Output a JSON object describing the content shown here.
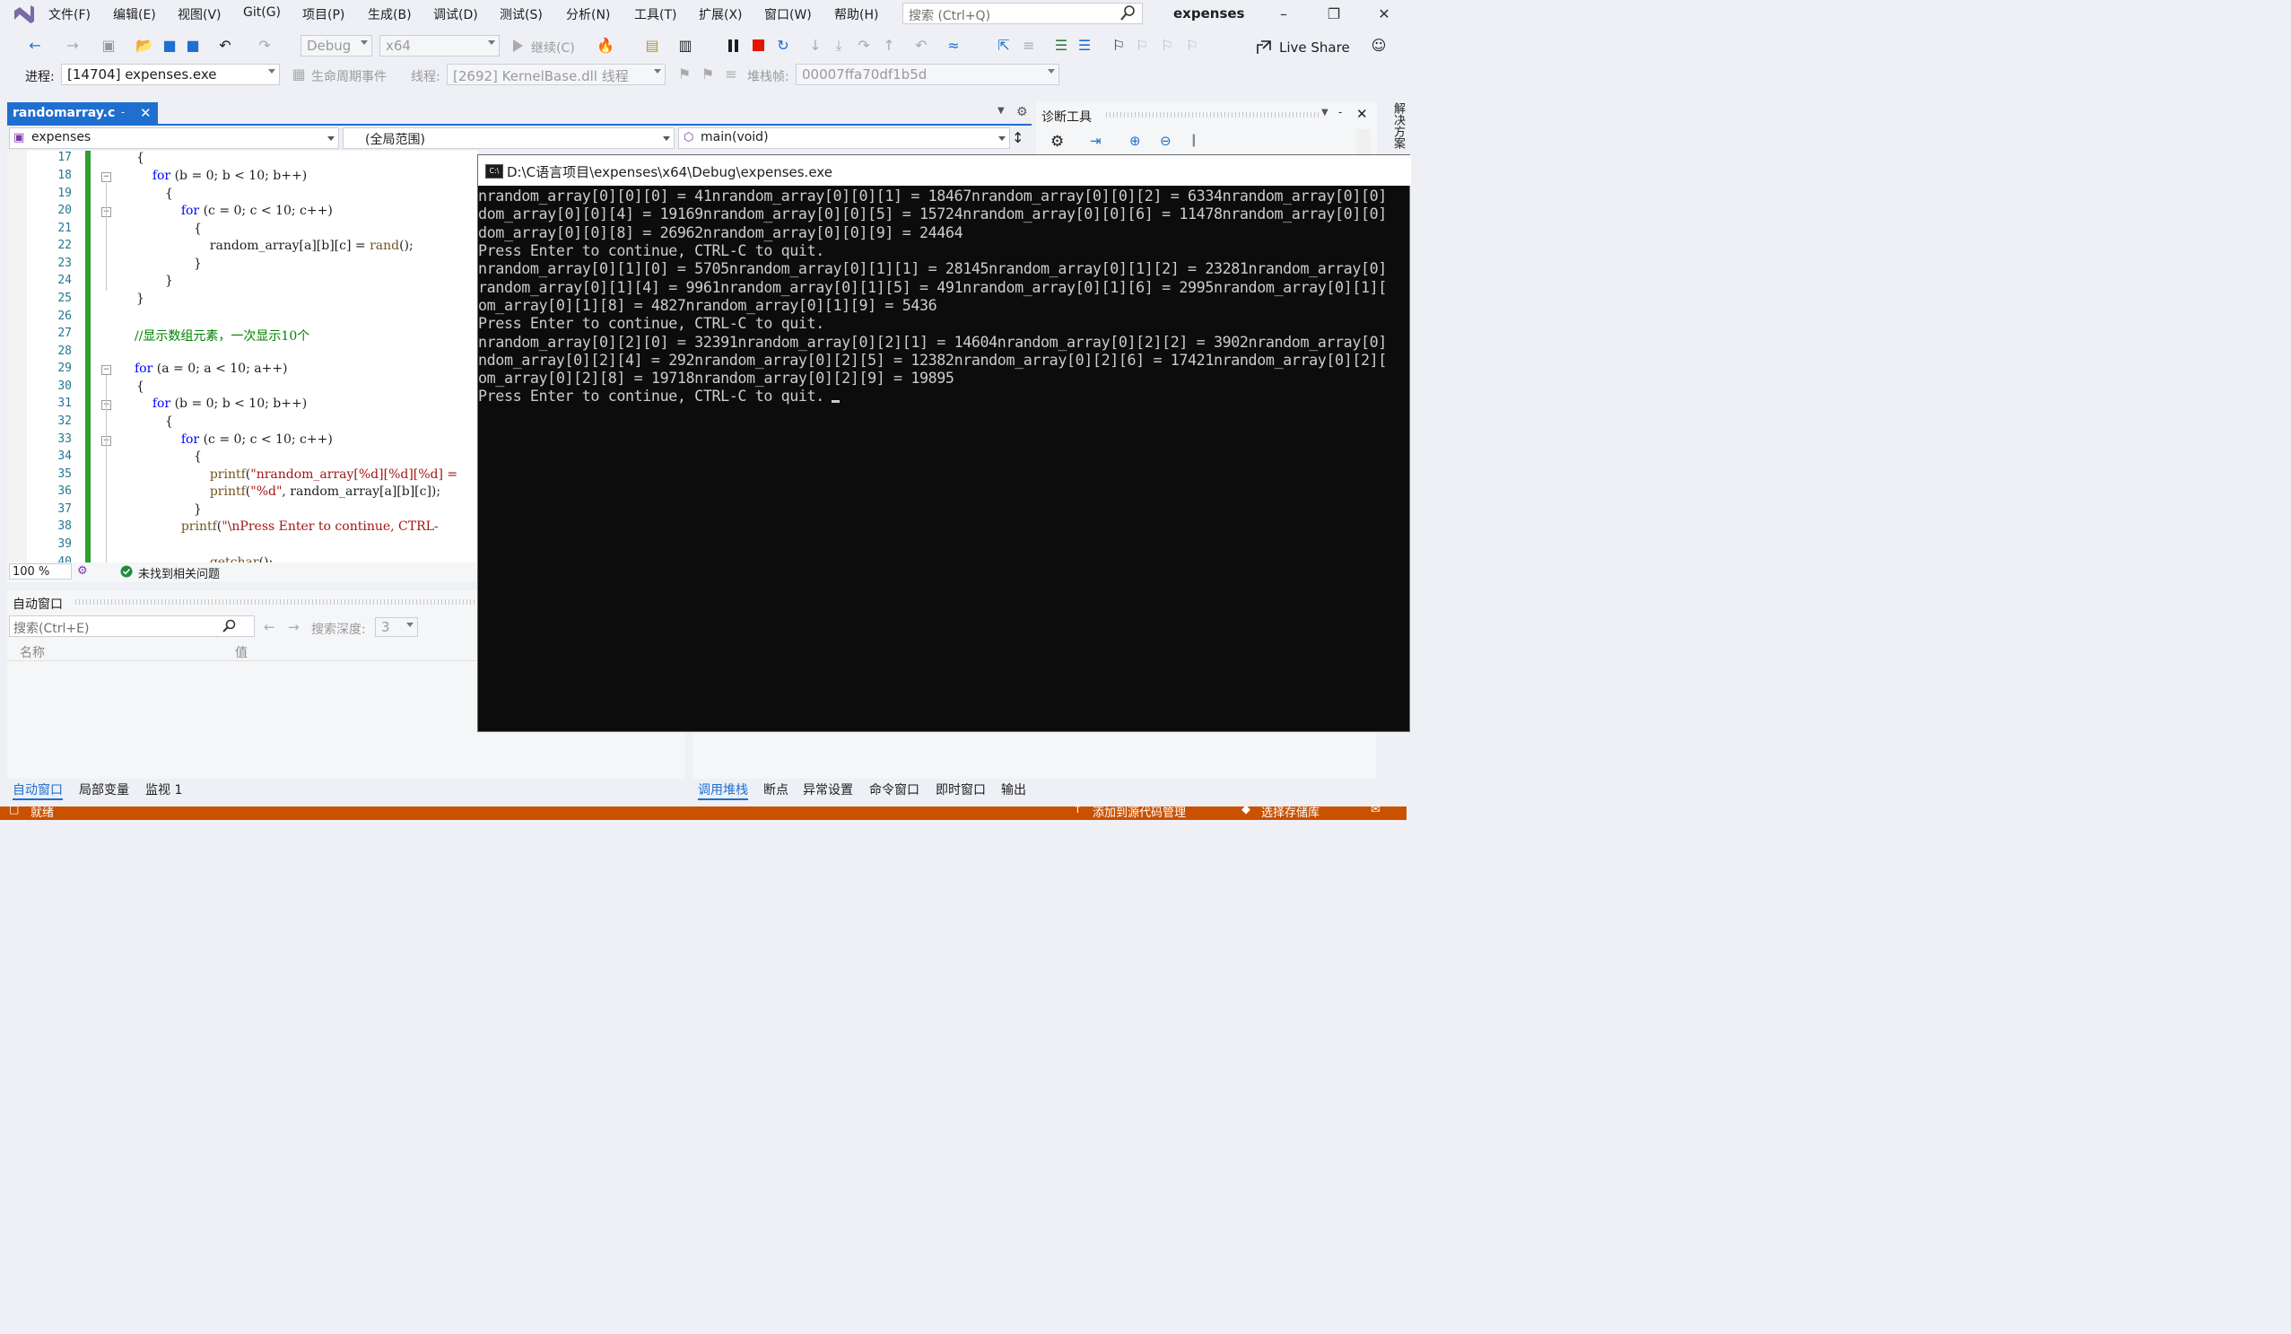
{
  "menu": [
    "文件(F)",
    "编辑(E)",
    "视图(V)",
    "Git(G)",
    "项目(P)",
    "生成(B)",
    "调试(D)",
    "测试(S)",
    "分析(N)",
    "工具(T)",
    "扩展(X)",
    "窗口(W)",
    "帮助(H)"
  ],
  "search": {
    "placeholder": "搜索 (Ctrl+Q)"
  },
  "solution_title": "expenses",
  "toolbar": {
    "config": "Debug",
    "platform": "x64",
    "continue_label": "继续(C)",
    "live_share": "Live Share"
  },
  "debug_location": {
    "process_label": "进程:",
    "process_value": "[14704] expenses.exe",
    "lifecycle_label": "生命周期事件",
    "thread_label": "线程:",
    "thread_value": "[2692] KernelBase.dll 线程",
    "stack_label": "堆栈帧:",
    "stack_value": "00007ffa70df1b5d"
  },
  "editor": {
    "tab_name": "randomarray.c",
    "nav_project": "expenses",
    "nav_scope": "(全局范围)",
    "nav_function": "main(void)",
    "line_numbers": [
      "17",
      "18",
      "19",
      "20",
      "21",
      "22",
      "23",
      "24",
      "25",
      "26",
      "27",
      "28",
      "29",
      "30",
      "31",
      "32",
      "33",
      "34",
      "35",
      "36",
      "37",
      "38",
      "39",
      "40"
    ],
    "zoom": "100 %",
    "issues": "未找到相关问题"
  },
  "autos": {
    "title": "自动窗口",
    "search_placeholder": "搜索(Ctrl+E)",
    "depth_label": "搜索深度:",
    "depth_value": "3",
    "col_name": "名称",
    "col_value": "值"
  },
  "bottom_tabs_left": [
    "自动窗口",
    "局部变量",
    "监视 1"
  ],
  "bottom_tabs_right": [
    "调用堆栈",
    "断点",
    "异常设置",
    "命令窗口",
    "即时窗口",
    "输出"
  ],
  "diagnostics_title": "诊断工具",
  "side_tab": "解决方案",
  "console": {
    "title": "D:\\C语言项目\\expenses\\x64\\Debug\\expenses.exe",
    "lines": [
      "nrandom_array[0][0][0] = 41nrandom_array[0][0][1] = 18467nrandom_array[0][0][2] = 6334nrandom_array[0][0]",
      "dom_array[0][0][4] = 19169nrandom_array[0][0][5] = 15724nrandom_array[0][0][6] = 11478nrandom_array[0][0]",
      "dom_array[0][0][8] = 26962nrandom_array[0][0][9] = 24464",
      "Press Enter to continue, CTRL-C to quit.",
      "nrandom_array[0][1][0] = 5705nrandom_array[0][1][1] = 28145nrandom_array[0][1][2] = 23281nrandom_array[0]",
      "random_array[0][1][4] = 9961nrandom_array[0][1][5] = 491nrandom_array[0][1][6] = 2995nrandom_array[0][1][",
      "om_array[0][1][8] = 4827nrandom_array[0][1][9] = 5436",
      "Press Enter to continue, CTRL-C to quit.",
      "nrandom_array[0][2][0] = 32391nrandom_array[0][2][1] = 14604nrandom_array[0][2][2] = 3902nrandom_array[0]",
      "ndom_array[0][2][4] = 292nrandom_array[0][2][5] = 12382nrandom_array[0][2][6] = 17421nrandom_array[0][2][",
      "om_array[0][2][8] = 19718nrandom_array[0][2][9] = 19895",
      "Press Enter to continue, CTRL-C to quit."
    ]
  },
  "status_bar": {
    "left": "就绪",
    "source_control": "添加到源代码管理",
    "repo": "选择存储库"
  }
}
